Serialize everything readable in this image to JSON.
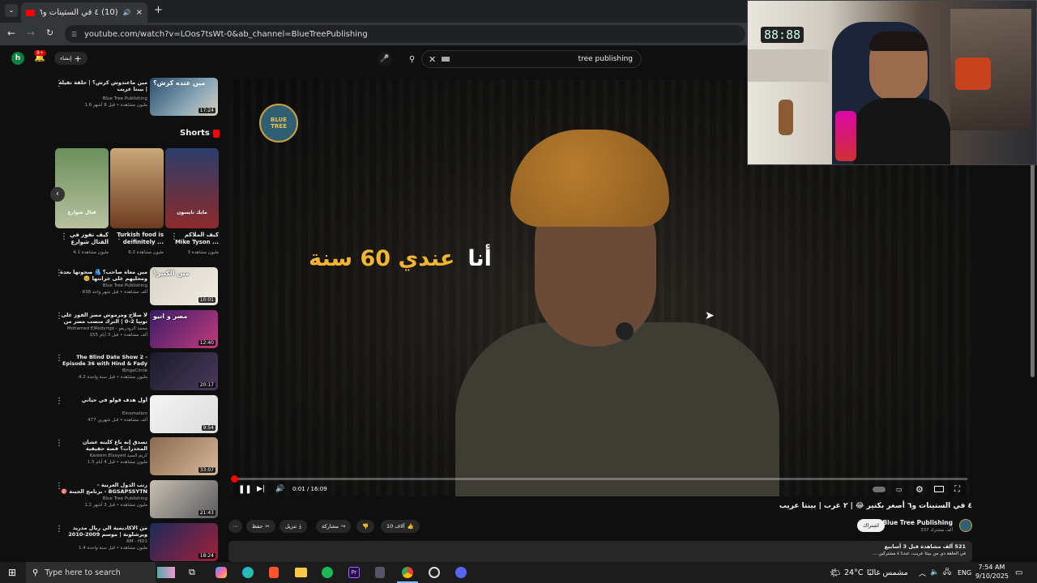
{
  "browser": {
    "tab_title": "(10) ٤ في الستينات و٦ أصغر",
    "url": "youtube.com/watch?v=LOos7tsWt-0&ab_channel=BlueTreePublishing"
  },
  "yt": {
    "create_label": "إنشاء",
    "notif_count": "9+",
    "avatar_letter": "h",
    "search_value": "tree publishing"
  },
  "sidebar": {
    "shorts_label": "Shorts",
    "top_video": {
      "title": "مين ماعندوش كرش؟ | حلقة تقيلة | بينتا عريب",
      "channel": "Blue Tree Publishing",
      "meta": "1.6 مليون مشاهدة • قبل 8 أشهر",
      "duration": "17:24",
      "thumb_text": "مين عنده كرش؟"
    },
    "shorts": [
      {
        "title": "كيف تفوز في القتال شوارع بلكمة ...",
        "views": "4.1 مليون مشاهدة",
        "overlay": "قتال شوارع"
      },
      {
        "title": "Turkish food is deifinitely ...",
        "views": "6.2 مليون مشاهدة",
        "overlay": ""
      },
      {
        "title": "كيف الملاكم Mike Tyson ...",
        "views": "3 مليون مشاهدة",
        "overlay": "مايك تايسون"
      }
    ],
    "videos": [
      {
        "title": "مين معاه صاحب؟ 🫂 صحوتها بعدة ومحليهم على خزانتها 🥺",
        "channel": "Blue Tree Publishing",
        "meta": "638 ألف مشاهدة • قبل شهر واحد",
        "duration": "10:01",
        "thumb_text": "مين الكبير؟"
      },
      {
        "title": "لا صلاح ومرموش مصر الفوز على تونيا 2-0 | الترك متصب مصر من التأهل ...",
        "channel": "Mohamed ElRodyrigo - محمد الرودريغو",
        "meta": "155 ألف مشاهدة • قبل 3 أيام",
        "duration": "12:40",
        "thumb_text": "مصر و انيو"
      },
      {
        "title": "The Blind Date Show 2 - Episode 36 with Hind & Fady",
        "channel": "BingeCircle",
        "meta": "4.2 مليون مشاهدة • قبل سنة واحدة",
        "duration": "20:17",
        "thumb_text": ""
      },
      {
        "title": "أول هدف قولو في حياتي",
        "channel": "Einomation",
        "meta": "477 ألف مشاهدة • قبل شهرين",
        "duration": "9:54",
        "thumb_text": ""
      },
      {
        "title": "تصدق إنه باع كليته عشان المخدرات؟ قصة حقيقية",
        "channel": "Kareem Elsayed كريم السيد",
        "meta": "1.5 مليون مشاهدة • قبل 4 أيام",
        "duration": "33:07",
        "thumb_text": ""
      },
      {
        "title": "رتب الدول العربية - BGSAPSSYTN - برنامج الجينة 🎯",
        "channel": "Blue Tree Publishing",
        "meta": "1.2 مليون مشاهدة • قبل 3 أشهر",
        "duration": "21:43",
        "thumb_text": ""
      },
      {
        "title": "من الاكاديمية الي ريال مدريد ويرشلونة | موسم 2009-2010 تشاوي عصام الدوالي جوده ...",
        "channel": "RM - HD1",
        "meta": "1.4 مليون مشاهدة • قبل سنة واحدة",
        "duration": "18:24",
        "thumb_text": ""
      }
    ]
  },
  "player": {
    "subtitle_a": "أنا",
    "subtitle_b": "عندي 60 سنة",
    "logo_text": "BLUE TREE",
    "time": "0:01 / 16:09",
    "progress": 0.001
  },
  "video": {
    "title": "٤ في الستينات و٦ أصغر بكتير 😂 | ٢ غرب | بينتا عريب",
    "channel": "Blue Tree Publishing",
    "subs": "337 ألف مشترك",
    "subscribe": "اشتراك",
    "likes": "10 آلاف",
    "share": "مشاركة",
    "download": "تنزيل",
    "clip": "حفظ",
    "desc_stats": "521 ألف مشاهدة  قبل 3 أسابيع",
    "desc_text": "في الحلقة دي من بينتا عريب، عندنا ٤ مشتركين ..."
  },
  "taskbar": {
    "search_placeholder": "Type here to search",
    "weather_temp": "24°C",
    "weather_desc": "مشمس غالبًا",
    "lang": "ENG",
    "time": "7:54 AM",
    "date": "9/10/2025"
  },
  "webcam": {
    "clock": "88:88"
  }
}
